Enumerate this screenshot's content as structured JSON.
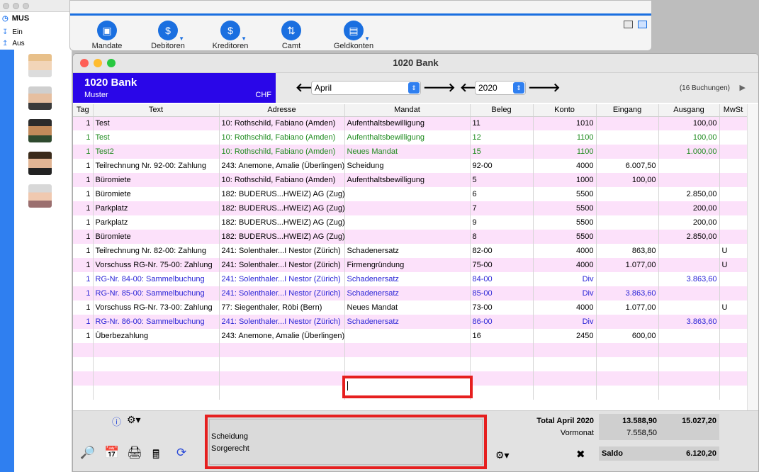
{
  "left": {
    "title": "MUS",
    "items": [
      "Ein",
      "Aus"
    ]
  },
  "toolbar": {
    "buttons": [
      {
        "label": "Mandate",
        "icon": "folder-icon"
      },
      {
        "label": "Debitoren",
        "icon": "person-money-icon"
      },
      {
        "label": "Kreditoren",
        "icon": "hand-money-icon"
      },
      {
        "label": "Camt",
        "icon": "exchange-arrows-icon"
      },
      {
        "label": "Geldkonten",
        "icon": "ledger-icon"
      }
    ]
  },
  "window": {
    "title": "1020 Bank"
  },
  "header": {
    "bank_name": "1020 Bank",
    "bank_owner": "Muster",
    "currency": "CHF",
    "month": "April",
    "year": "2020",
    "bookings": "(16 Buchungen)"
  },
  "table": {
    "columns": [
      "Tag",
      "Text",
      "Adresse",
      "Mandat",
      "Beleg",
      "Konto",
      "Eingang",
      "Ausgang",
      "MwSt"
    ],
    "rows": [
      {
        "style": "pink",
        "cells": [
          "1",
          "Test",
          "10: Rothschild, Fabiano (Amden)",
          "Aufenthaltsbewilligung",
          "11",
          "1010",
          "",
          "100,00",
          ""
        ]
      },
      {
        "style": "white green",
        "cells": [
          "1",
          "Test",
          "10: Rothschild, Fabiano (Amden)",
          "Aufenthaltsbewilligung",
          "12",
          "1100",
          "",
          "100,00",
          ""
        ]
      },
      {
        "style": "pink green",
        "cells": [
          "1",
          "Test2",
          "10: Rothschild, Fabiano (Amden)",
          "Neues Mandat",
          "15",
          "1100",
          "",
          "1.000,00",
          ""
        ]
      },
      {
        "style": "white",
        "cells": [
          "1",
          "Teilrechnung Nr. 92-00: Zahlung",
          "243: Anemone, Amalie (Überlingen)",
          "Scheidung",
          "92-00",
          "4000",
          "6.007,50",
          "",
          ""
        ]
      },
      {
        "style": "pink",
        "cells": [
          "1",
          "Büromiete",
          "10: Rothschild, Fabiano (Amden)",
          "Aufenthaltsbewilligung",
          "5",
          "1000",
          "100,00",
          "",
          ""
        ]
      },
      {
        "style": "white",
        "cells": [
          "1",
          "Büromiete",
          "182: BUDERUS...HWEIZ) AG (Zug)",
          "",
          "6",
          "5500",
          "",
          "2.850,00",
          ""
        ]
      },
      {
        "style": "pink",
        "cells": [
          "1",
          "Parkplatz",
          "182: BUDERUS...HWEIZ) AG (Zug)",
          "",
          "7",
          "5500",
          "",
          "200,00",
          ""
        ]
      },
      {
        "style": "white",
        "cells": [
          "1",
          "Parkplatz",
          "182: BUDERUS...HWEIZ) AG (Zug)",
          "",
          "9",
          "5500",
          "",
          "200,00",
          ""
        ]
      },
      {
        "style": "pink",
        "cells": [
          "1",
          "Büromiete",
          "182: BUDERUS...HWEIZ) AG (Zug)",
          "",
          "8",
          "5500",
          "",
          "2.850,00",
          ""
        ]
      },
      {
        "style": "white",
        "cells": [
          "1",
          "Teilrechnung Nr. 82-00: Zahlung",
          "241: Solenthaler...I Nestor (Zürich)",
          "Schadenersatz",
          "82-00",
          "4000",
          "863,80",
          "",
          "U"
        ]
      },
      {
        "style": "pink",
        "cells": [
          "1",
          "Vorschuss RG-Nr. 75-00: Zahlung",
          "241: Solenthaler...I Nestor (Zürich)",
          "Firmengründung",
          "75-00",
          "4000",
          "1.077,00",
          "",
          "U"
        ]
      },
      {
        "style": "white blue",
        "cells": [
          "1",
          "RG-Nr. 84-00: Sammelbuchung",
          "241: Solenthaler...I Nestor (Zürich)",
          "Schadenersatz",
          "84-00",
          "Div",
          "",
          "3.863,60",
          ""
        ]
      },
      {
        "style": "pink blue",
        "cells": [
          "1",
          "RG-Nr. 85-00: Sammelbuchung",
          "241: Solenthaler...I Nestor (Zürich)",
          "Schadenersatz",
          "85-00",
          "Div",
          "3.863,60",
          "",
          ""
        ]
      },
      {
        "style": "white",
        "cells": [
          "1",
          "Vorschuss RG-Nr. 73-00: Zahlung",
          "77: Siegenthaler, Röbi (Bern)",
          "Neues Mandat",
          "73-00",
          "4000",
          "1.077,00",
          "",
          "U"
        ]
      },
      {
        "style": "pink blue",
        "cells": [
          "1",
          "RG-Nr. 86-00: Sammelbuchung",
          "241: Solenthaler...I Nestor (Zürich)",
          "Schadenersatz",
          "86-00",
          "Div",
          "",
          "3.863,60",
          ""
        ]
      },
      {
        "style": "white",
        "cells": [
          "1",
          "Überbezahlung",
          "243: Anemone, Amalie (Überlingen)",
          "",
          "16",
          "2450",
          "600,00",
          "",
          ""
        ]
      }
    ],
    "empty_rows": 4
  },
  "memo": {
    "lines": [
      "Scheidung",
      "Sorgerecht"
    ]
  },
  "totals": {
    "total_label": "Total April 2020",
    "total_in": "13.588,90",
    "total_out": "15.027,20",
    "prev_label": "Vormonat",
    "prev_in": "7.558,50",
    "saldo_label": "Saldo",
    "saldo": "6.120,20"
  },
  "colors": {
    "accent": "#2a06e8",
    "pink_row": "#fce1fa",
    "green_text": "#1d8a1d",
    "blue_text": "#2a24d6",
    "highlight": "#e61f1f"
  }
}
